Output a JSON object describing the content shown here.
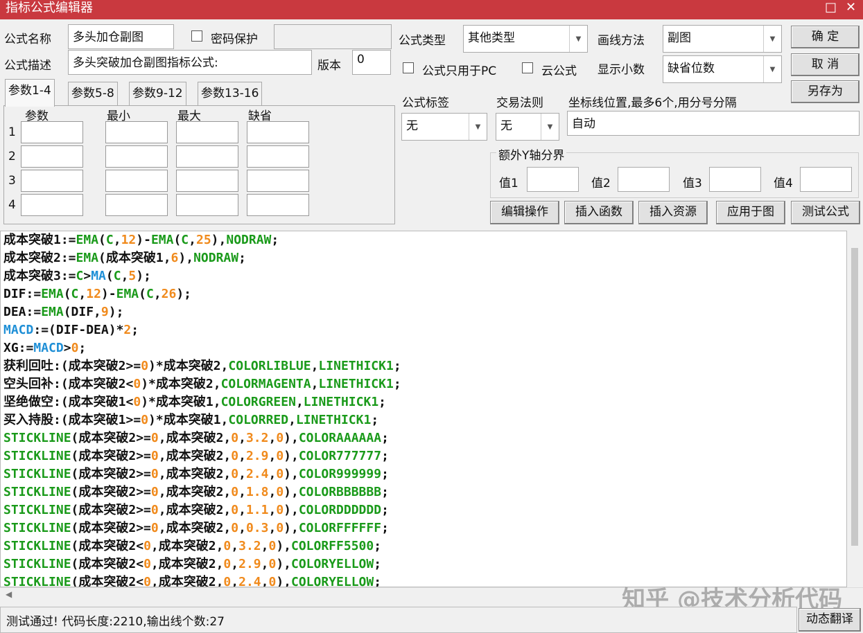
{
  "window": {
    "title": "指标公式编辑器",
    "maximize": "□",
    "close": "✕"
  },
  "form": {
    "name_label": "公式名称",
    "name_value": "多头加仓副图",
    "password_label": "密码保护",
    "password_value": "",
    "desc_label": "公式描述",
    "desc_value": "多头突破加仓副图指标公式:",
    "version_label": "版本",
    "version_value": "0",
    "type_label": "公式类型",
    "type_value": "其他类型",
    "draw_label": "画线方法",
    "draw_value": "副图",
    "pc_only_label": "公式只用于PC",
    "cloud_label": "云公式",
    "decimals_label": "显示小数",
    "decimals_value": "缺省位数",
    "tag_label": "公式标签",
    "tag_value": "无",
    "rule_label": "交易法则",
    "rule_value": "无",
    "axis_label": "坐标线位置,最多6个,用分号分隔",
    "axis_value": "自动",
    "yaxis_group": "额外Y轴分界",
    "v1": "值1",
    "v2": "值2",
    "v3": "值3",
    "v4": "值4"
  },
  "buttons": {
    "ok": "确 定",
    "cancel": "取 消",
    "save_as": "另存为",
    "edit": "编辑操作",
    "insert_func": "插入函数",
    "insert_res": "插入资源",
    "apply": "应用于图",
    "test": "测试公式",
    "translate": "动态翻译"
  },
  "tabs": [
    "参数1-4",
    "参数5-8",
    "参数9-12",
    "参数13-16"
  ],
  "param_headers": [
    "参数",
    "最小",
    "最大",
    "缺省"
  ],
  "param_rows": [
    "1",
    "2",
    "3",
    "4"
  ],
  "code": [
    [
      [
        "成本突破1:=",
        "p"
      ],
      [
        "EMA",
        "g"
      ],
      [
        "(",
        "p"
      ],
      [
        "C",
        "g"
      ],
      [
        ",",
        "p"
      ],
      [
        "12",
        "n"
      ],
      [
        ")-",
        "p"
      ],
      [
        "EMA",
        "g"
      ],
      [
        "(",
        "p"
      ],
      [
        "C",
        "g"
      ],
      [
        ",",
        "p"
      ],
      [
        "25",
        "n"
      ],
      [
        "),",
        "p"
      ],
      [
        "NODRAW",
        "g"
      ],
      [
        ";",
        "p"
      ]
    ],
    [
      [
        "成本突破2:=",
        "p"
      ],
      [
        "EMA",
        "g"
      ],
      [
        "(成本突破1,",
        "p"
      ],
      [
        "6",
        "n"
      ],
      [
        "),",
        "p"
      ],
      [
        "NODRAW",
        "g"
      ],
      [
        ";",
        "p"
      ]
    ],
    [
      [
        "成本突破3:=",
        "p"
      ],
      [
        "C",
        "g"
      ],
      [
        ">",
        "p"
      ],
      [
        "MA",
        "b"
      ],
      [
        "(",
        "p"
      ],
      [
        "C",
        "g"
      ],
      [
        ",",
        "p"
      ],
      [
        "5",
        "n"
      ],
      [
        ");",
        "p"
      ]
    ],
    [
      [
        "DIF:=",
        "p"
      ],
      [
        "EMA",
        "g"
      ],
      [
        "(",
        "p"
      ],
      [
        "C",
        "g"
      ],
      [
        ",",
        "p"
      ],
      [
        "12",
        "n"
      ],
      [
        ")-",
        "p"
      ],
      [
        "EMA",
        "g"
      ],
      [
        "(",
        "p"
      ],
      [
        "C",
        "g"
      ],
      [
        ",",
        "p"
      ],
      [
        "26",
        "n"
      ],
      [
        ");",
        "p"
      ]
    ],
    [
      [
        "DEA:=",
        "p"
      ],
      [
        "EMA",
        "g"
      ],
      [
        "(DIF,",
        "p"
      ],
      [
        "9",
        "n"
      ],
      [
        ");",
        "p"
      ]
    ],
    [
      [
        "MACD",
        "b"
      ],
      [
        ":=(DIF-DEA)*",
        "p"
      ],
      [
        "2",
        "n"
      ],
      [
        ";",
        "p"
      ]
    ],
    [
      [
        "XG:=",
        "p"
      ],
      [
        "MACD",
        "b"
      ],
      [
        ">",
        "p"
      ],
      [
        "0",
        "n"
      ],
      [
        ";",
        "p"
      ]
    ],
    [
      [
        "获利回吐:(成本突破2>=",
        "p"
      ],
      [
        "0",
        "n"
      ],
      [
        ")*成本突破2,",
        "p"
      ],
      [
        "COLORLIBLUE",
        "g"
      ],
      [
        ",",
        "p"
      ],
      [
        "LINETHICK1",
        "g"
      ],
      [
        ";",
        "p"
      ]
    ],
    [
      [
        "空头回补:(成本突破2<",
        "p"
      ],
      [
        "0",
        "n"
      ],
      [
        ")*成本突破2,",
        "p"
      ],
      [
        "COLORMAGENTA",
        "g"
      ],
      [
        ",",
        "p"
      ],
      [
        "LINETHICK1",
        "g"
      ],
      [
        ";",
        "p"
      ]
    ],
    [
      [
        "坚绝做空:(成本突破1<",
        "p"
      ],
      [
        "0",
        "n"
      ],
      [
        ")*成本突破1,",
        "p"
      ],
      [
        "COLORGREEN",
        "g"
      ],
      [
        ",",
        "p"
      ],
      [
        "LINETHICK1",
        "g"
      ],
      [
        ";",
        "p"
      ]
    ],
    [
      [
        "买入持股:(成本突破1>=",
        "p"
      ],
      [
        "0",
        "n"
      ],
      [
        ")*成本突破1,",
        "p"
      ],
      [
        "COLORRED",
        "g"
      ],
      [
        ",",
        "p"
      ],
      [
        "LINETHICK1",
        "g"
      ],
      [
        ";",
        "p"
      ]
    ],
    [
      [
        "STICKLINE",
        "g"
      ],
      [
        "(成本突破2>=",
        "p"
      ],
      [
        "0",
        "n"
      ],
      [
        ",成本突破2,",
        "p"
      ],
      [
        "0",
        "n"
      ],
      [
        ",",
        "p"
      ],
      [
        "3.2",
        "n"
      ],
      [
        ",",
        "p"
      ],
      [
        "0",
        "n"
      ],
      [
        "),",
        "p"
      ],
      [
        "COLORAAAAAA",
        "g"
      ],
      [
        ";",
        "p"
      ]
    ],
    [
      [
        "STICKLINE",
        "g"
      ],
      [
        "(成本突破2>=",
        "p"
      ],
      [
        "0",
        "n"
      ],
      [
        ",成本突破2,",
        "p"
      ],
      [
        "0",
        "n"
      ],
      [
        ",",
        "p"
      ],
      [
        "2.9",
        "n"
      ],
      [
        ",",
        "p"
      ],
      [
        "0",
        "n"
      ],
      [
        "),",
        "p"
      ],
      [
        "COLOR777777",
        "g"
      ],
      [
        ";",
        "p"
      ]
    ],
    [
      [
        "STICKLINE",
        "g"
      ],
      [
        "(成本突破2>=",
        "p"
      ],
      [
        "0",
        "n"
      ],
      [
        ",成本突破2,",
        "p"
      ],
      [
        "0",
        "n"
      ],
      [
        ",",
        "p"
      ],
      [
        "2.4",
        "n"
      ],
      [
        ",",
        "p"
      ],
      [
        "0",
        "n"
      ],
      [
        "),",
        "p"
      ],
      [
        "COLOR999999",
        "g"
      ],
      [
        ";",
        "p"
      ]
    ],
    [
      [
        "STICKLINE",
        "g"
      ],
      [
        "(成本突破2>=",
        "p"
      ],
      [
        "0",
        "n"
      ],
      [
        ",成本突破2,",
        "p"
      ],
      [
        "0",
        "n"
      ],
      [
        ",",
        "p"
      ],
      [
        "1.8",
        "n"
      ],
      [
        ",",
        "p"
      ],
      [
        "0",
        "n"
      ],
      [
        "),",
        "p"
      ],
      [
        "COLORBBBBBB",
        "g"
      ],
      [
        ";",
        "p"
      ]
    ],
    [
      [
        "STICKLINE",
        "g"
      ],
      [
        "(成本突破2>=",
        "p"
      ],
      [
        "0",
        "n"
      ],
      [
        ",成本突破2,",
        "p"
      ],
      [
        "0",
        "n"
      ],
      [
        ",",
        "p"
      ],
      [
        "1.1",
        "n"
      ],
      [
        ",",
        "p"
      ],
      [
        "0",
        "n"
      ],
      [
        "),",
        "p"
      ],
      [
        "COLORDDDDDD",
        "g"
      ],
      [
        ";",
        "p"
      ]
    ],
    [
      [
        "STICKLINE",
        "g"
      ],
      [
        "(成本突破2>=",
        "p"
      ],
      [
        "0",
        "n"
      ],
      [
        ",成本突破2,",
        "p"
      ],
      [
        "0",
        "n"
      ],
      [
        ",",
        "p"
      ],
      [
        "0.3",
        "n"
      ],
      [
        ",",
        "p"
      ],
      [
        "0",
        "n"
      ],
      [
        "),",
        "p"
      ],
      [
        "COLORFFFFFF",
        "g"
      ],
      [
        ";",
        "p"
      ]
    ],
    [
      [
        "STICKLINE",
        "g"
      ],
      [
        "(成本突破2<",
        "p"
      ],
      [
        "0",
        "n"
      ],
      [
        ",成本突破2,",
        "p"
      ],
      [
        "0",
        "n"
      ],
      [
        ",",
        "p"
      ],
      [
        "3.2",
        "n"
      ],
      [
        ",",
        "p"
      ],
      [
        "0",
        "n"
      ],
      [
        "),",
        "p"
      ],
      [
        "COLORFF5500",
        "g"
      ],
      [
        ";",
        "p"
      ]
    ],
    [
      [
        "STICKLINE",
        "g"
      ],
      [
        "(成本突破2<",
        "p"
      ],
      [
        "0",
        "n"
      ],
      [
        ",成本突破2,",
        "p"
      ],
      [
        "0",
        "n"
      ],
      [
        ",",
        "p"
      ],
      [
        "2.9",
        "n"
      ],
      [
        ",",
        "p"
      ],
      [
        "0",
        "n"
      ],
      [
        "),",
        "p"
      ],
      [
        "COLORYELLOW",
        "g"
      ],
      [
        ";",
        "p"
      ]
    ],
    [
      [
        "STICKLINE",
        "g"
      ],
      [
        "(成本突破2<",
        "p"
      ],
      [
        "0",
        "n"
      ],
      [
        ",成本突破2,",
        "p"
      ],
      [
        "0",
        "n"
      ],
      [
        ",",
        "p"
      ],
      [
        "2.4",
        "n"
      ],
      [
        ",",
        "p"
      ],
      [
        "0",
        "n"
      ],
      [
        "),",
        "p"
      ],
      [
        "COLORYELLOW",
        "g"
      ],
      [
        ";",
        "p"
      ]
    ]
  ],
  "status": "测试通过! 代码长度:2210,输出线个数:27",
  "watermark": "知乎 @技术分析代码",
  "colors": {
    "title_bar": "#c9393f",
    "keyword": "#1a9a1a",
    "number": "#f08a1c",
    "function": "#1f8fd6"
  }
}
